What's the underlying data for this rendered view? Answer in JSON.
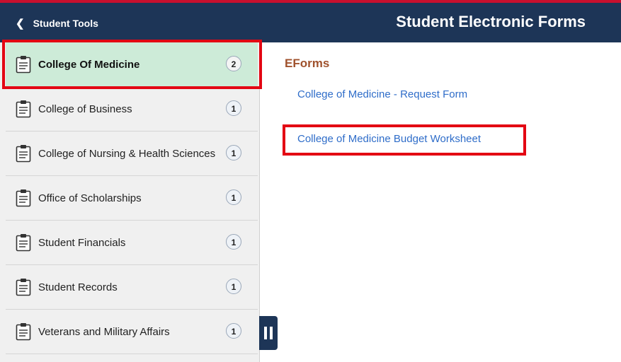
{
  "header": {
    "back_label": "Student Tools",
    "title": "Student Electronic Forms"
  },
  "sidebar": {
    "items": [
      {
        "label": "College Of Medicine",
        "count": "2"
      },
      {
        "label": "College of Business",
        "count": "1"
      },
      {
        "label": "College of Nursing & Health Sciences",
        "count": "1"
      },
      {
        "label": "Office of Scholarships",
        "count": "1"
      },
      {
        "label": "Student Financials",
        "count": "1"
      },
      {
        "label": "Student Records",
        "count": "1"
      },
      {
        "label": "Veterans and Military Affairs",
        "count": "1"
      }
    ]
  },
  "main": {
    "section_title": "EForms",
    "links": [
      {
        "label": "College of Medicine - Request Form"
      },
      {
        "label": "College of Medicine Budget Worksheet"
      }
    ]
  },
  "colors": {
    "header_bg": "#1d3557",
    "active_bg": "#cdebd8",
    "highlight": "#e30613",
    "link": "#2f6dc9",
    "section_title": "#a0522d"
  }
}
